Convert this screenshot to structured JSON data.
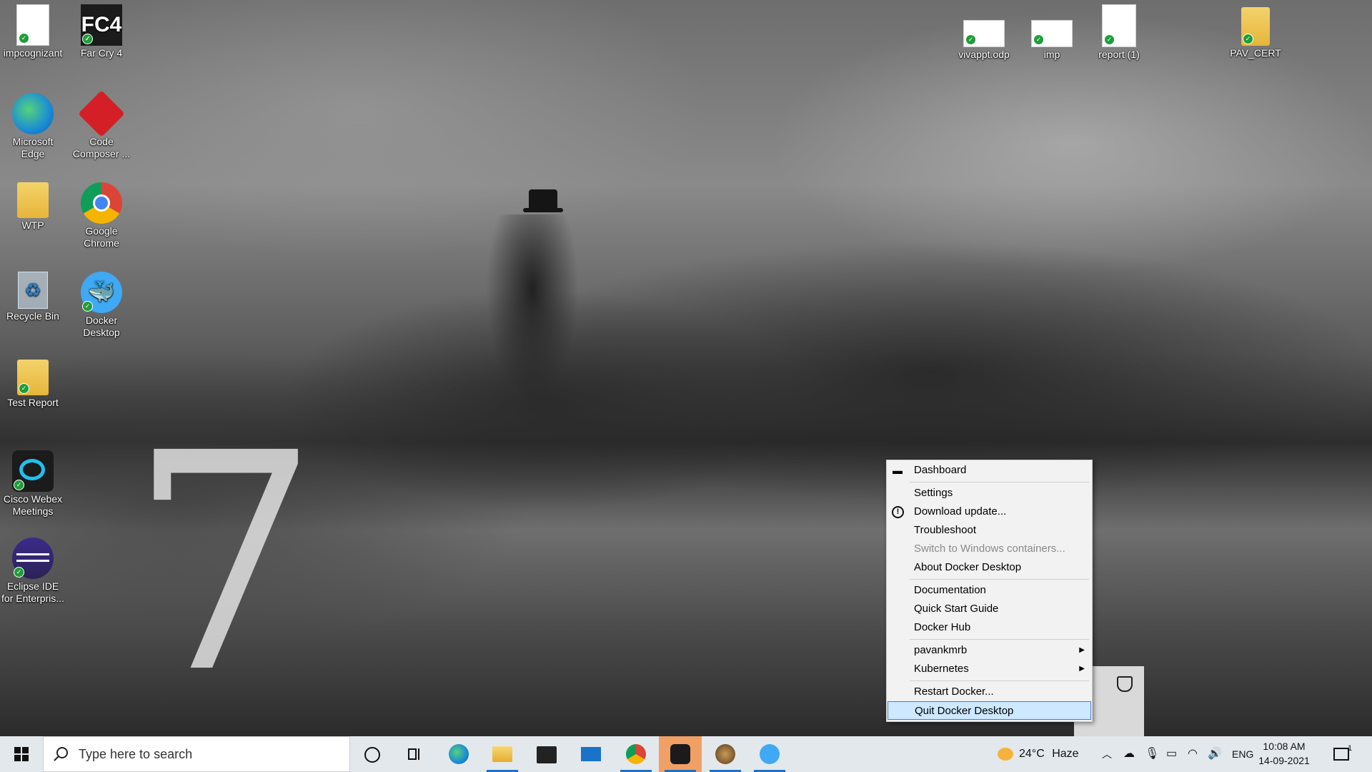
{
  "desktop_icons": [
    {
      "label": "impcognizant",
      "icon": "document-icon"
    },
    {
      "label": "Far Cry 4",
      "icon": "game-icon",
      "badge": "FC4"
    },
    {
      "label": "vivappt.odp",
      "icon": "presentation-icon"
    },
    {
      "label": "imp",
      "icon": "document-icon"
    },
    {
      "label": "report (1)",
      "icon": "edge-pdf-icon"
    },
    {
      "label": "PAV_CERT",
      "icon": "zip-folder-icon"
    },
    {
      "label": "Microsoft Edge",
      "icon": "edge-icon"
    },
    {
      "label": "Code Composer ...",
      "icon": "code-composer-icon"
    },
    {
      "label": "WTP",
      "icon": "folder-icon"
    },
    {
      "label": "Google Chrome",
      "icon": "chrome-icon"
    },
    {
      "label": "Recycle Bin",
      "icon": "recycle-bin-icon"
    },
    {
      "label": "Docker Desktop",
      "icon": "docker-icon"
    },
    {
      "label": "Test Report",
      "icon": "folder-icon"
    },
    {
      "label": "Cisco Webex Meetings",
      "icon": "webex-icon"
    },
    {
      "label": "Eclipse IDE for Enterpris...",
      "icon": "eclipse-icon"
    }
  ],
  "context_menu": {
    "items": [
      {
        "label": "Dashboard",
        "icon": "dashboard-icon"
      },
      {
        "label": "Settings"
      },
      {
        "label": "Download update...",
        "icon": "update-alert-icon"
      },
      {
        "label": "Troubleshoot"
      },
      {
        "label": "Switch to Windows containers...",
        "disabled": true
      },
      {
        "label": "About Docker Desktop"
      },
      {
        "label": "Documentation"
      },
      {
        "label": "Quick Start Guide"
      },
      {
        "label": "Docker Hub"
      },
      {
        "label": "pavankmrb",
        "submenu": true
      },
      {
        "label": "Kubernetes",
        "submenu": true
      },
      {
        "label": "Restart Docker..."
      },
      {
        "label": "Quit Docker Desktop",
        "highlighted": true
      }
    ]
  },
  "taskbar": {
    "search_placeholder": "Type here to search",
    "apps": [
      "cortana-icon",
      "task-view-icon",
      "edge-icon",
      "file-explorer-icon",
      "store-icon",
      "mail-icon",
      "chrome-icon",
      "webex-icon",
      "game-icon",
      "docker-icon"
    ],
    "weather": {
      "temp": "24°C",
      "condition": "Haze"
    },
    "language": "ENG",
    "time": "10:08 AM",
    "date": "14-09-2021",
    "notification_count": "1"
  },
  "colors": {
    "menu_highlight": "#cde8ff",
    "taskbar": "#e3e8ed",
    "active_app": "#f0a065",
    "running_indicator": "#1a73c9"
  }
}
